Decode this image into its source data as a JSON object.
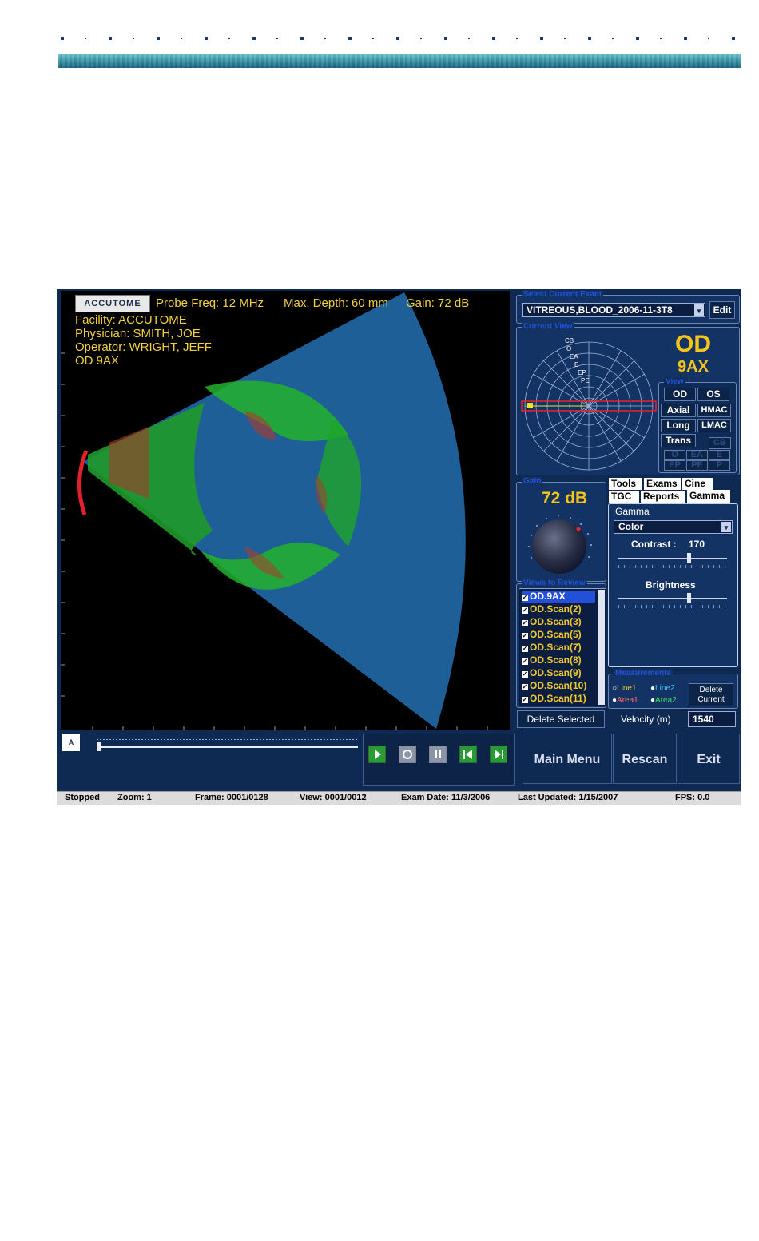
{
  "viewer": {
    "logo_text": "ACCUTOME",
    "probe_freq": "Probe Freq: 12 MHz",
    "max_depth": "Max. Depth: 60 mm",
    "gain": "Gain: 72 dB",
    "facility": "Facility: ACCUTOME",
    "physician": "Physician: SMITH, JOE",
    "operator": "Operator: WRIGHT, JEFF",
    "eye_view": "OD  9AX"
  },
  "exam": {
    "title": "Select Current Exam",
    "value": "VITREOUS,BLOOD_2006-11-3T8",
    "edit": "Edit"
  },
  "current_view": {
    "title": "Current View",
    "eye": "OD",
    "view": "9AX",
    "labels": [
      "CB",
      "O",
      "EA",
      "E",
      "EP",
      "PE"
    ],
    "selector_title": "View",
    "buttons": [
      "OD",
      "OS",
      "Axial",
      "HMAC",
      "Long",
      "LMAC",
      "Trans",
      "CB",
      "O",
      "EA",
      "E",
      "EP",
      "PE",
      "P"
    ]
  },
  "gain_panel": {
    "title": "Gain",
    "value": "72 dB"
  },
  "views_review": {
    "title": "Views to Review",
    "items": [
      "OD.9AX",
      "OD.Scan(2)",
      "OD.Scan(3)",
      "OD.Scan(5)",
      "OD.Scan(7)",
      "OD.Scan(8)",
      "OD.Scan(9)",
      "OD.Scan(10)",
      "OD.Scan(11)"
    ],
    "delete_label": "Delete Selected"
  },
  "tabs": {
    "row1": [
      "Tools",
      "Exams",
      "Cine"
    ],
    "row2": [
      "TGC",
      "Reports",
      "Gamma"
    ],
    "active": "Gamma"
  },
  "gamma": {
    "title": "Gamma",
    "mode": "Color",
    "contrast_label": "Contrast :",
    "contrast_value": "170",
    "brightness_label": "Brightness",
    "contrast_level": 0.65,
    "brightness_level": 0.65
  },
  "measurements": {
    "title": "Measurements",
    "line1": "Line1",
    "line2": "Line2",
    "area1": "Area1",
    "area2": "Area2",
    "delete_line1": "Delete",
    "delete_line2": "Current",
    "velocity_label": "Velocity (m)",
    "velocity_value": "1540",
    "colors": {
      "line1": "#f2c92b",
      "line2": "#3cc3ff",
      "area1": "#ff6a6a",
      "area2": "#33e35a"
    }
  },
  "transport": {
    "icons": [
      "play-icon",
      "stop-icon",
      "pause-icon",
      "step-back-icon",
      "step-forward-icon"
    ],
    "position": 0.0
  },
  "main_buttons": {
    "main_menu": "Main Menu",
    "rescan": "Rescan",
    "exit": "Exit"
  },
  "status": {
    "state": "Stopped",
    "zoom": "Zoom: 1",
    "frame": "Frame: 0001/0128",
    "view": "View: 0001/0012",
    "exam_date": "Exam Date: 11/3/2006",
    "last_updated": "Last Updated: 1/15/2007",
    "fps": "FPS: 0.0"
  }
}
